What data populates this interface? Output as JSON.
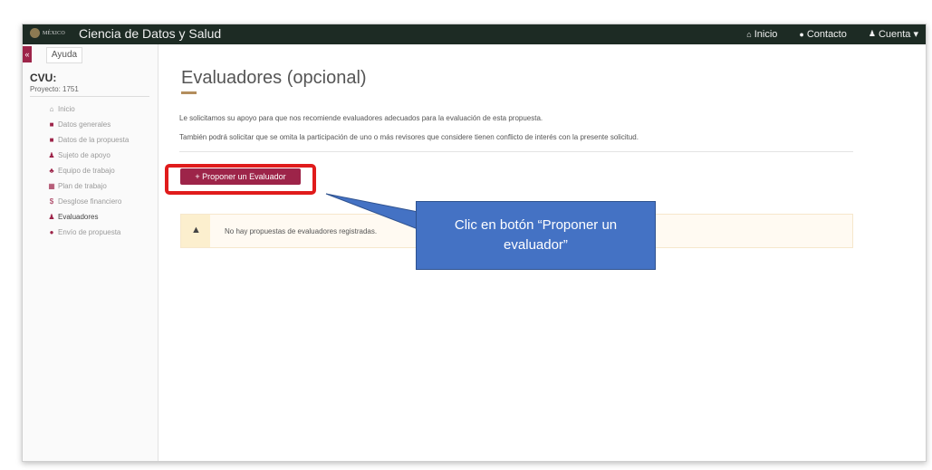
{
  "topbar": {
    "logo_text": "MÉXICO",
    "title": "Ciencia de Datos y Salud",
    "nav": [
      {
        "label": "Inicio",
        "icon": "home-icon"
      },
      {
        "label": "Contacto",
        "icon": "chat-icon"
      },
      {
        "label": "Cuenta ▾",
        "icon": "user-icon"
      }
    ]
  },
  "sidebar": {
    "toggle": "«",
    "help_tab": "Ayuda",
    "cvu_label": "CVU:",
    "project": "Proyecto: 1751",
    "items": [
      {
        "label": "Inicio",
        "icon": "home-icon"
      },
      {
        "label": "Datos generales",
        "icon": "file-icon"
      },
      {
        "label": "Datos de la propuesta",
        "icon": "file-icon"
      },
      {
        "label": "Sujeto de apoyo",
        "icon": "user-icon"
      },
      {
        "label": "Equipo de trabajo",
        "icon": "users-icon"
      },
      {
        "label": "Plan de trabajo",
        "icon": "calendar-icon"
      },
      {
        "label": "Desglose financiero",
        "icon": "dollar-icon"
      },
      {
        "label": "Evaluadores",
        "icon": "user-check-icon"
      },
      {
        "label": "Envío de propuesta",
        "icon": "check-circle-icon"
      }
    ]
  },
  "main": {
    "title": "Evaluadores (opcional)",
    "intro_line1": "Le solicitamos su apoyo para que nos recomiende evaluadores adecuados para la evaluación de esta propuesta.",
    "intro_line2": "También podrá solicitar que se omita la participación de uno o más revisores que considere tienen conflicto de interés con la presente solicitud.",
    "propose_button": "+ Proponer un Evaluador",
    "warning_text": "No hay propuestas de evaluadores registradas."
  },
  "callout": {
    "text": "Clic en botón “Proponer un evaluador”"
  },
  "colors": {
    "topbar": "#1d2b24",
    "accent": "#9d2449",
    "gold": "#b38e5d",
    "callout": "#4472c4",
    "highlight": "#e01b1b"
  }
}
